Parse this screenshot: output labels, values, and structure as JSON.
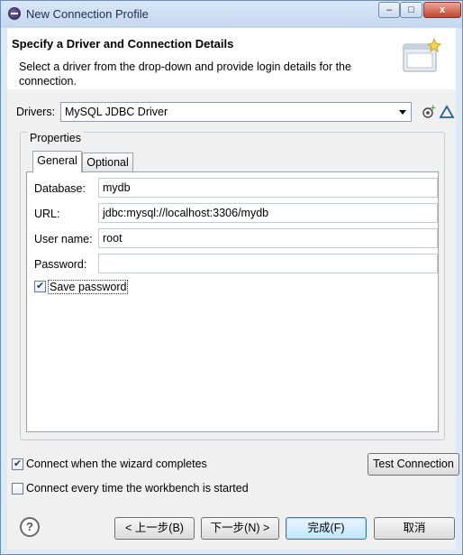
{
  "window": {
    "title": "New Connection Profile",
    "controls": {
      "minimize": "–",
      "maximize": "□",
      "close": "x"
    }
  },
  "header": {
    "title": "Specify a Driver and Connection Details",
    "description": "Select a driver from the drop-down and provide login details for the connection."
  },
  "drivers": {
    "label": "Drivers:",
    "selected": "MySQL JDBC Driver",
    "icons": [
      "new-driver-icon",
      "edit-driver-icon"
    ]
  },
  "properties": {
    "group_label": "Properties",
    "tabs": [
      {
        "label": "General",
        "active": true
      },
      {
        "label": "Optional",
        "active": false
      }
    ],
    "fields": [
      {
        "label": "Database:",
        "value": "mydb"
      },
      {
        "label": "URL:",
        "value": "jdbc:mysql://localhost:3306/mydb"
      },
      {
        "label": "User name:",
        "value": "root"
      },
      {
        "label": "Password:",
        "value": ""
      }
    ],
    "save_password": {
      "label": "Save password",
      "checked": true
    }
  },
  "options": {
    "connect_on_finish": {
      "label": "Connect when the wizard completes",
      "checked": true
    },
    "connect_on_startup": {
      "label": "Connect every time the workbench is started",
      "checked": false
    },
    "test_connection": "Test Connection"
  },
  "footer": {
    "back": "< 上一步(B)",
    "next": "下一步(N) >",
    "finish": "完成(F)",
    "cancel": "取消"
  },
  "colors": {
    "accent": "#3c7fb1",
    "window_frame": "#6d8db5",
    "close_button": "#c4442c"
  }
}
